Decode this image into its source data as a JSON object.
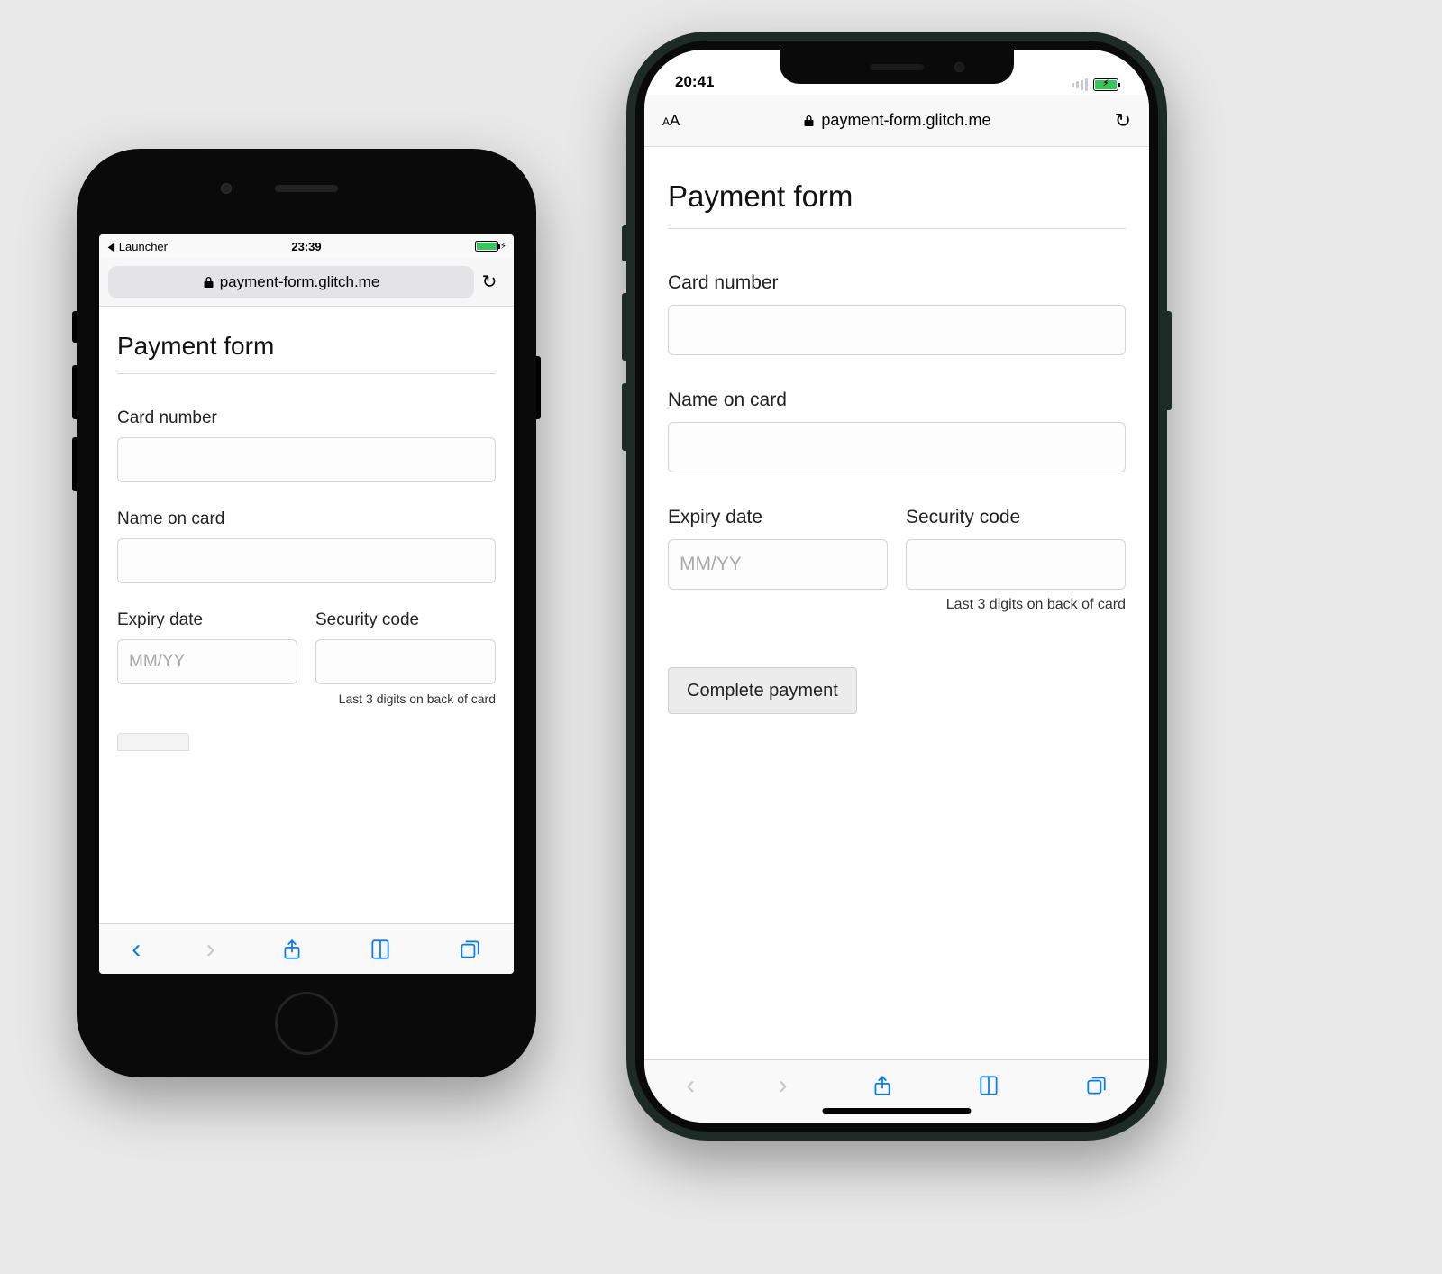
{
  "phone_a": {
    "status": {
      "back_app": "Launcher",
      "time": "23:39"
    },
    "address": {
      "url": "payment-form.glitch.me"
    },
    "toolbar": {}
  },
  "phone_b": {
    "status": {
      "time": "20:41"
    },
    "address": {
      "aa_small": "A",
      "aa_large": "A",
      "url": "payment-form.glitch.me"
    },
    "toolbar": {}
  },
  "form": {
    "title": "Payment form",
    "card_number_label": "Card number",
    "name_label": "Name on card",
    "expiry_label": "Expiry date",
    "expiry_placeholder": "MM/YY",
    "security_label": "Security code",
    "security_hint": "Last 3 digits on back of card",
    "submit_label": "Complete payment"
  }
}
